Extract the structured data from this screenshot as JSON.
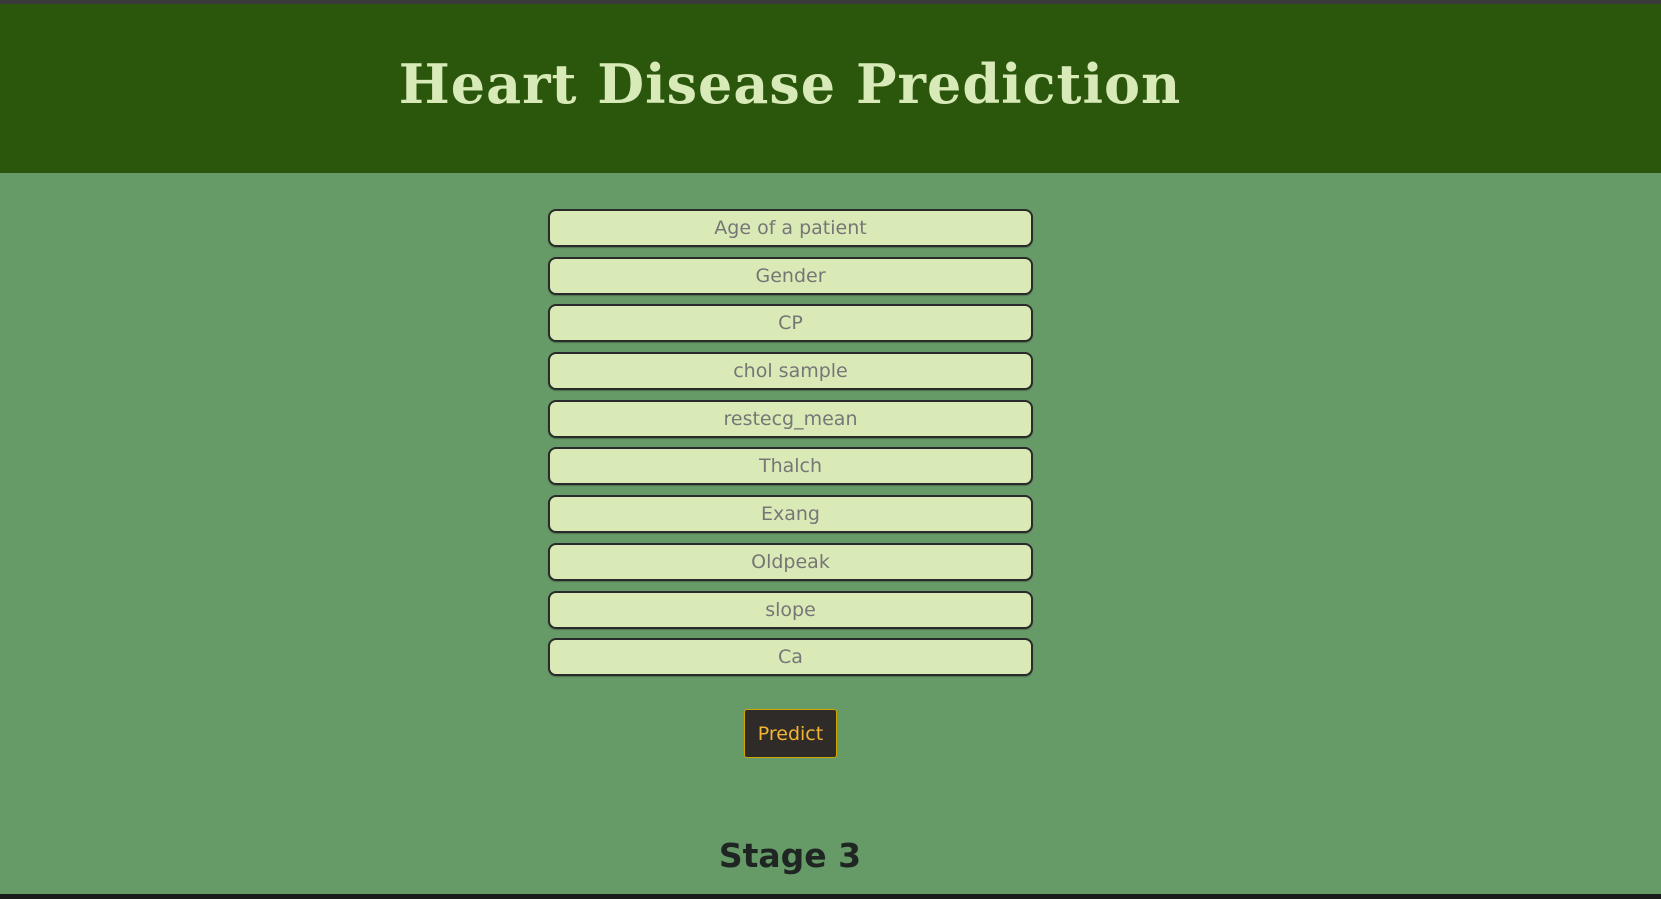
{
  "header": {
    "title": "Heart Disease Prediction"
  },
  "form": {
    "fields": [
      {
        "placeholder": "Age of a patient",
        "value": ""
      },
      {
        "placeholder": "Gender",
        "value": ""
      },
      {
        "placeholder": "CP",
        "value": ""
      },
      {
        "placeholder": "chol sample",
        "value": ""
      },
      {
        "placeholder": "restecg_mean",
        "value": ""
      },
      {
        "placeholder": "Thalch",
        "value": ""
      },
      {
        "placeholder": "Exang",
        "value": ""
      },
      {
        "placeholder": "Oldpeak",
        "value": ""
      },
      {
        "placeholder": "slope",
        "value": ""
      },
      {
        "placeholder": "Ca",
        "value": ""
      }
    ],
    "submit_label": "Predict"
  },
  "result": {
    "text": "Stage 3"
  },
  "colors": {
    "header_bg": "#2b570c",
    "page_bg": "#669a67",
    "field_bg": "#d9eab7",
    "title_color": "#d8eab8",
    "button_bg": "#2f2b28",
    "button_text": "#f2b632"
  }
}
